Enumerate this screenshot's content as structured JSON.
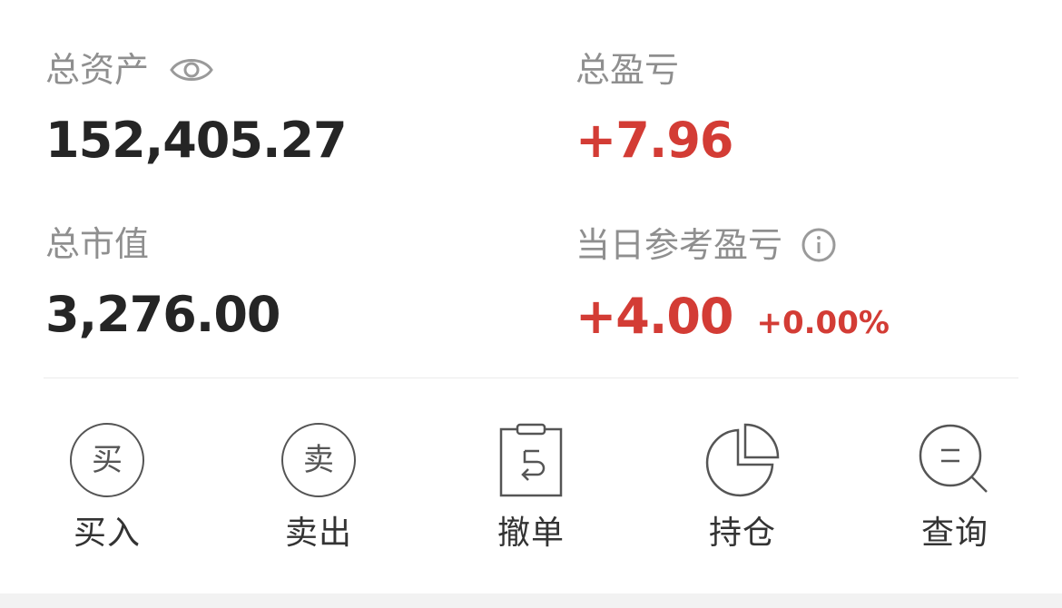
{
  "assets": {
    "total_assets_label": "总资产",
    "total_assets_value": "152,405.27",
    "total_pnl_label": "总盈亏",
    "total_pnl_value": "+7.96",
    "market_value_label": "总市值",
    "market_value_value": "3,276.00",
    "daily_pnl_label": "当日参考盈亏",
    "daily_pnl_value": "+4.00",
    "daily_pnl_pct": "+0.00%"
  },
  "actions": [
    {
      "label": "买入",
      "icon": "buy-icon",
      "icon_char": "买"
    },
    {
      "label": "卖出",
      "icon": "sell-icon",
      "icon_char": "卖"
    },
    {
      "label": "撤单",
      "icon": "cancel-order-icon"
    },
    {
      "label": "持仓",
      "icon": "pie-chart-icon"
    },
    {
      "label": "查询",
      "icon": "search-icon"
    }
  ],
  "colors": {
    "gain_red": "#d33c35",
    "label_gray": "#8f8f8f",
    "value_dark": "#252525"
  }
}
